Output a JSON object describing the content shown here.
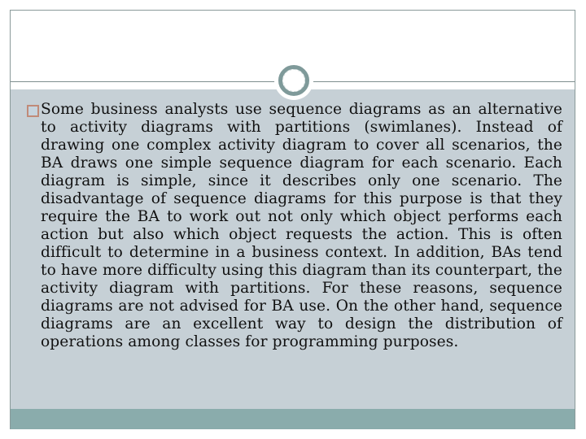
{
  "slide": {
    "title": "",
    "bullets": [
      {
        "icon": "hollow-square-bullet",
        "text": "Some business analysts use sequence diagrams as an alternative to activity diagrams with partitions (swimlanes). Instead of drawing one complex activity diagram to cover all scenarios, the BA draws one simple sequence diagram for each scenario. Each diagram is simple, since it  describes only one scenario. The disadvantage of sequence diagrams for this purpose is that they require the BA to work out not only which object performs each action but also which object requests the action. This is often difficult to determine in a business context. In addition, BAs tend to have more difficulty using this diagram than its counterpart,  the activity diagram with partitions. For these reasons, sequence diagrams are not advised for BA use. On the other hand, sequence diagrams are an excellent way to design the distribution of operations among classes for programming purposes."
      }
    ]
  },
  "colors": {
    "content_background": "#c6d0d6",
    "footer_bar": "#8aacac",
    "ornament_ring": "#7f9a9a",
    "bullet_border": "#c08a78",
    "frame_border": "#8a9a9a",
    "text": "#111111"
  }
}
